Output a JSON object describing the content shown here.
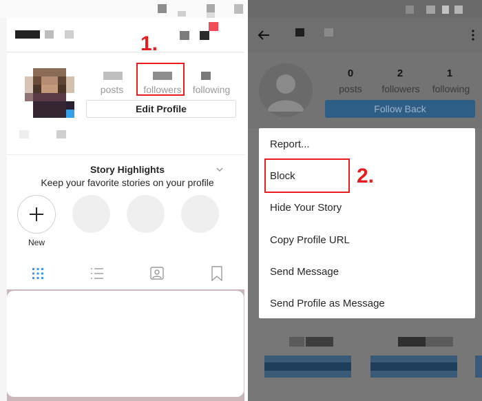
{
  "left": {
    "stats": {
      "posts_label": "posts",
      "followers_label": "followers",
      "following_label": "following"
    },
    "edit_profile_label": "Edit Profile",
    "highlights": {
      "title": "Story Highlights",
      "subtitle": "Keep your favorite stories on your profile",
      "new_label": "New"
    },
    "step_label": "1."
  },
  "right": {
    "stats": {
      "posts_value": "0",
      "posts_label": "posts",
      "followers_value": "2",
      "followers_label": "followers",
      "following_value": "1",
      "following_label": "following"
    },
    "follow_back_label": "Follow Back",
    "menu": [
      "Report...",
      "Block",
      "Hide Your Story",
      "Copy Profile URL",
      "Send Message",
      "Send Profile as Message"
    ],
    "step_label": "2."
  },
  "colors": {
    "accent_red": "#e81c1c",
    "follow_blue": "#3897f0",
    "grid_blue": "#3897f0"
  }
}
